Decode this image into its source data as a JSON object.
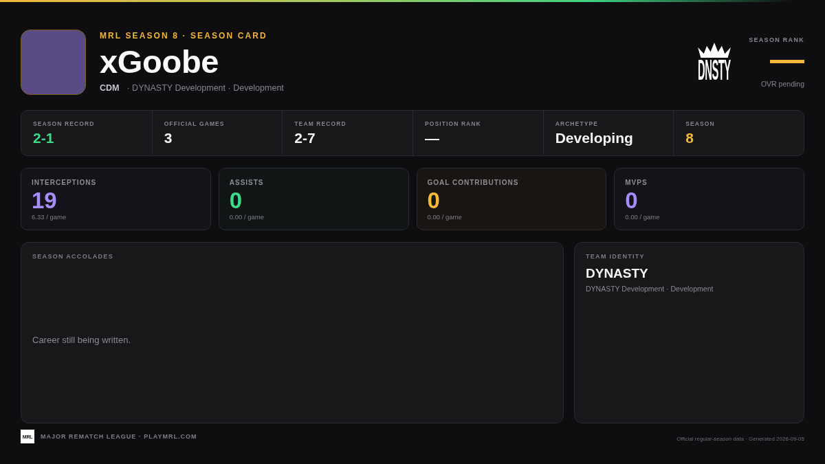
{
  "header": {
    "kicker": "MRL SEASON 8 · SEASON CARD"
  },
  "player": {
    "name": "xGoobe",
    "position": "CDM",
    "team_line": "· DYNASTY Development · Development"
  },
  "team_logo": {
    "text": "DNSTY"
  },
  "season_rank": {
    "label": "SEASON RANK",
    "value": "—",
    "note": "OVR pending"
  },
  "summary": [
    {
      "label": "SEASON RECORD",
      "value": "2-1",
      "color": "#3fd98a"
    },
    {
      "label": "OFFICIAL GAMES",
      "value": "3",
      "color": "#f4f4f5"
    },
    {
      "label": "TEAM RECORD",
      "value": "2-7",
      "color": "#f4f4f5"
    },
    {
      "label": "POSITION RANK",
      "value": "—",
      "color": "#f4f4f5"
    },
    {
      "label": "ARCHETYPE",
      "value": "Developing",
      "color": "#f4f4f5"
    },
    {
      "label": "SEASON",
      "value": "8",
      "color": "#f5b83d"
    }
  ],
  "stat_cards": [
    {
      "label": "INTERCEPTIONS",
      "value": "19",
      "per_game": "6.33 / game",
      "color": "#a78bfa"
    },
    {
      "label": "ASSISTS",
      "value": "0",
      "per_game": "0.00 / game",
      "color": "#3fd98a"
    },
    {
      "label": "GOAL CONTRIBUTIONS",
      "value": "0",
      "per_game": "0.00 / game",
      "color": "#f5b83d"
    },
    {
      "label": "MVPS",
      "value": "0",
      "per_game": "0.00 / game",
      "color": "#a78bfa"
    }
  ],
  "accolades": {
    "title": "SEASON ACCOLADES",
    "empty_text": "Career still being written."
  },
  "team_identity": {
    "title": "TEAM IDENTITY",
    "name": "DYNASTY",
    "detail": "DYNASTY Development · Development"
  },
  "footer": {
    "logo_text": "MRL",
    "credit": "MAJOR REMATCH LEAGUE · PLAYMRL.COM",
    "note": "Official regular-season data · Generated 2026-09-05"
  }
}
